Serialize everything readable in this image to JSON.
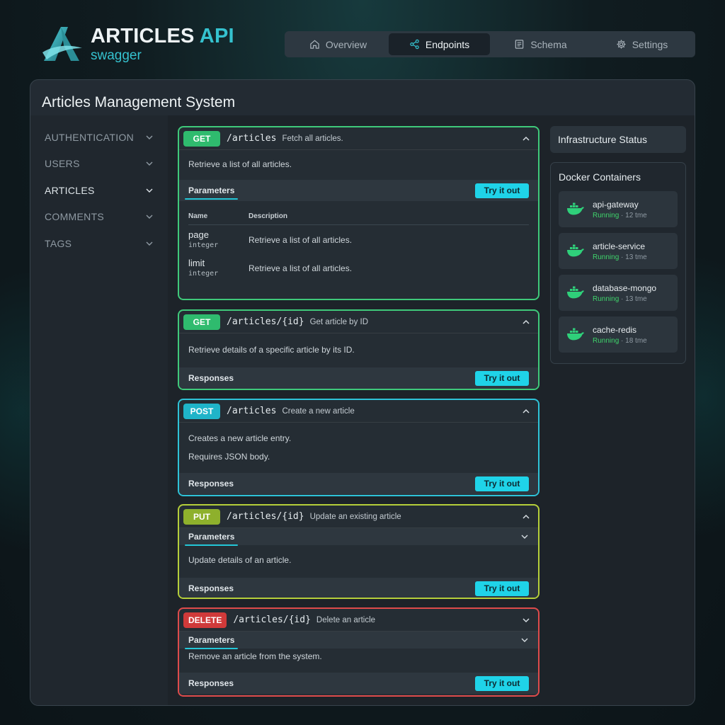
{
  "brand": {
    "title_main": "ARTICLES",
    "title_accent": "API",
    "subtitle": "swagger"
  },
  "nav": [
    {
      "label": "Overview",
      "icon": "home-icon"
    },
    {
      "label": "Endpoints",
      "icon": "share-icon"
    },
    {
      "label": "Schema",
      "icon": "document-icon"
    },
    {
      "label": "Settings",
      "icon": "gear-icon"
    }
  ],
  "panel": {
    "title": "Articles Management System"
  },
  "sidebar": {
    "items": [
      {
        "label": "AUTHENTICATION"
      },
      {
        "label": "USERS"
      },
      {
        "label": "ARTICLES"
      },
      {
        "label": "COMMENTS"
      },
      {
        "label": "TAGS"
      }
    ]
  },
  "colors": {
    "get": "#2fbb6e",
    "post": "#1fb4c9",
    "put": "#8eb02c",
    "delete": "#d03a3a",
    "accent": "#1fd3e8"
  },
  "endpoints": [
    {
      "method": "GET",
      "path": "/articles",
      "summary": "Fetch all articles.",
      "description": "Retrieve a list of all articles.",
      "bar_label": "Parameters",
      "try_label": "Try it out",
      "table_headers": {
        "name": "Name",
        "description": "Description"
      },
      "params": [
        {
          "name": "page",
          "type": "integer",
          "description": "Retrieve a list of all articles."
        },
        {
          "name": "limit",
          "type": "integer",
          "description": "Retrieve a list of all articles."
        }
      ]
    },
    {
      "method": "GET",
      "path": "/articles/{id}",
      "summary": "Get article by ID",
      "description": "Retrieve details of a specific article by its ID.",
      "bar_label": "Responses",
      "try_label": "Try it out"
    },
    {
      "method": "POST",
      "path": "/articles",
      "summary": "Create a new article",
      "description": "Creates a new article entry.",
      "description2": "Requires JSON body.",
      "bar_label": "Responses",
      "try_label": "Try it out"
    },
    {
      "method": "PUT",
      "path": "/articles/{id}",
      "summary": "Update an existing article",
      "params_label": "Parameters",
      "description": "Update details of an article.",
      "bar_label": "Responses",
      "try_label": "Try it out"
    },
    {
      "method": "DELETE",
      "path": "/articles/{id}",
      "summary": "Delete an article",
      "params_label": "Parameters",
      "description": "Remove an article from the system.",
      "bar_label": "Responses",
      "try_label": "Try it out"
    }
  ],
  "infrastructure": {
    "title": "Infrastructure Status",
    "docker_title": "Docker Containers",
    "containers": [
      {
        "name": "api-gateway",
        "status": "Running",
        "uptime": "· 12 tme"
      },
      {
        "name": "article-service",
        "status": "Running",
        "uptime": "· 13 tme"
      },
      {
        "name": "database-mongo",
        "status": "Running",
        "uptime": "· 13 tme"
      },
      {
        "name": "cache-redis",
        "status": "Running",
        "uptime": "· 18 tme"
      }
    ]
  }
}
